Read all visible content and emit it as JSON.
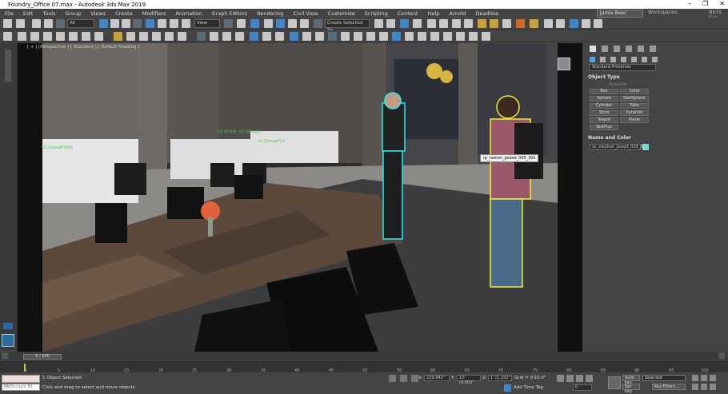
{
  "title": "Foundry_Office 07.max - Autodesk 3ds Max 2019",
  "window_buttons": {
    "minimize": "–",
    "maximize": "❐",
    "close": "✕"
  },
  "menu": [
    "File",
    "Edit",
    "Tools",
    "Group",
    "Views",
    "Create",
    "Modifiers",
    "Animation",
    "Graph Editors",
    "Rendering",
    "Civil View",
    "Customize",
    "Scripting",
    "Content",
    "Help",
    "Arnold",
    "Deadline"
  ],
  "user": "Jamie Beec",
  "workspaces_label": "Workspaces:",
  "workspace_value": "Nicl's Cur",
  "toolbar": {
    "filter": "All",
    "refcoord": "View",
    "selection_set": "Create Selection Se"
  },
  "viewport": {
    "label": "[ + ] [Perspective ] [ Standard ] [ Default Shading ]"
  },
  "scene_labels": [
    "v2 (Grind. v2 (Group)",
    "v2 (GroupF(k)",
    "v2 (GroupF)001"
  ],
  "tooltip": "rp_ramon_posed_005_30k",
  "cmd_panel": {
    "dropdown": "Standard Primitives",
    "object_type_title": "Object Type",
    "autogrid": "AutoGrid",
    "buttons": [
      "Box",
      "Cone",
      "Sphere",
      "GeoSphere",
      "Cylinder",
      "Tube",
      "Torus",
      "Pyramid",
      "Teapot",
      "Plane",
      "TextPlus"
    ],
    "name_color_title": "Name and Color",
    "object_name": "rp_stephen_posed_029_3"
  },
  "time_slider": "0 / 100",
  "ruler_ticks": [
    "0",
    "5",
    "10",
    "15",
    "20",
    "25",
    "30",
    "35",
    "40",
    "45",
    "50",
    "55",
    "60",
    "65",
    "70",
    "75",
    "80",
    "85",
    "90",
    "95",
    "100"
  ],
  "status": {
    "script_label": "MAXScript Mi",
    "selected": "1 Object Selected",
    "prompt": "Click and drag to select and move objects",
    "x_label": "X:",
    "x_val": "229.942\"",
    "y_label": "Y:",
    "y_val": "13' (0.002\"",
    "z_label": "Z:",
    "z_val": "1' (1.152\"",
    "grid": "Grid = 0'10.0\"",
    "add_time_tag": "Add Time Tag",
    "autokey": "Auto Key",
    "setkey": "Set Key",
    "selected_dd": "Selected",
    "keyfilters": "Key Filters...",
    "frame": "0"
  }
}
